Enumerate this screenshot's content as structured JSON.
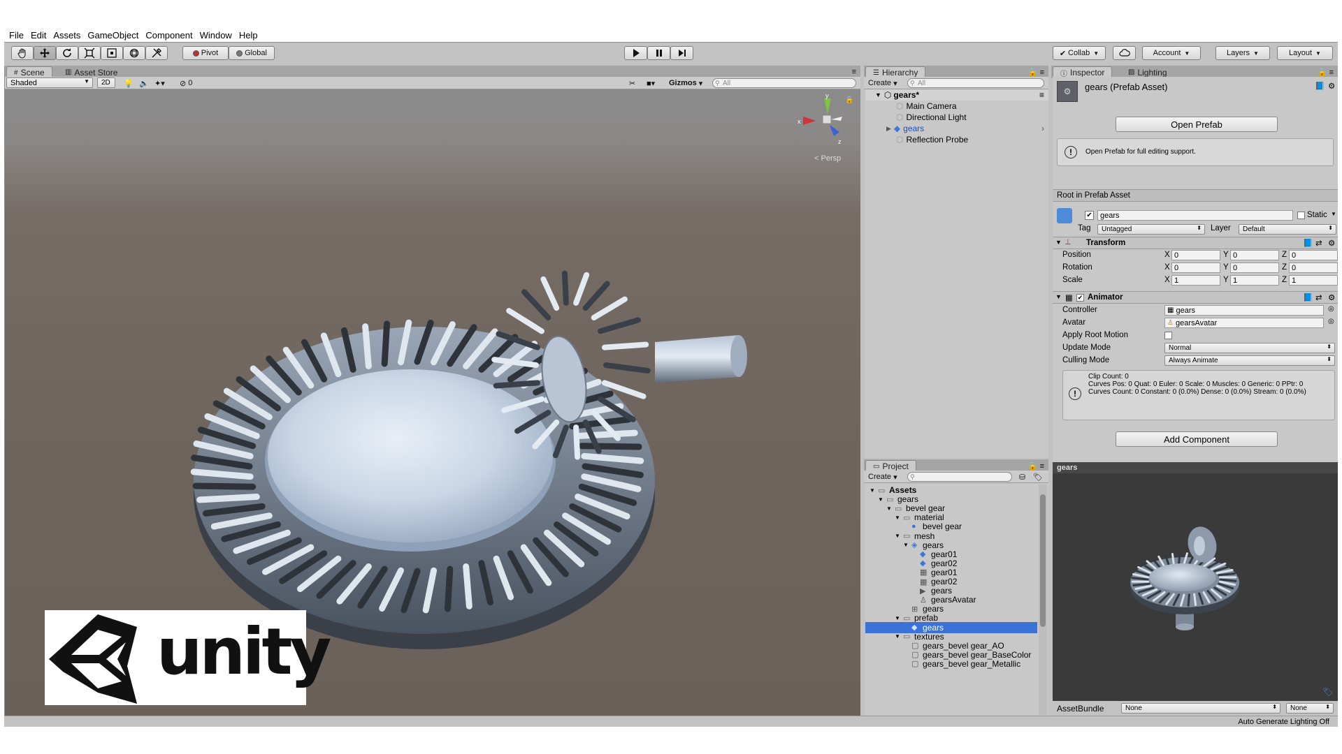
{
  "menu": [
    "File",
    "Edit",
    "Assets",
    "GameObject",
    "Component",
    "Window",
    "Help"
  ],
  "toolbar": {
    "pivot": "Pivot",
    "global": "Global",
    "collab": "Collab",
    "account": "Account",
    "layers": "Layers",
    "layout": "Layout"
  },
  "scene_panel": {
    "tabs": [
      "Scene",
      "Asset Store"
    ],
    "shading": "Shaded",
    "mode_2d": "2D",
    "hidden_count": "0",
    "gizmos": "Gizmos",
    "search_placeholder": "All",
    "persp": "Persp",
    "gizmo_axes": {
      "x": "x",
      "y": "y",
      "z": "z"
    }
  },
  "hierarchy": {
    "tab": "Hierarchy",
    "create": "Create",
    "search_placeholder": "All",
    "scene_name": "gears*",
    "items": [
      "Main Camera",
      "Directional Light",
      "gears",
      "Reflection Probe"
    ]
  },
  "project": {
    "tab": "Project",
    "create": "Create",
    "tree": [
      {
        "label": "Assets",
        "depth": 0,
        "type": "folder",
        "bold": true
      },
      {
        "label": "gears",
        "depth": 1,
        "type": "folder"
      },
      {
        "label": "bevel gear",
        "depth": 2,
        "type": "folder"
      },
      {
        "label": "material",
        "depth": 3,
        "type": "folder"
      },
      {
        "label": "bevel gear",
        "depth": 4,
        "type": "material"
      },
      {
        "label": "mesh",
        "depth": 3,
        "type": "folder"
      },
      {
        "label": "gears",
        "depth": 4,
        "type": "model"
      },
      {
        "label": "gear01",
        "depth": 5,
        "type": "cube"
      },
      {
        "label": "gear02",
        "depth": 5,
        "type": "cube"
      },
      {
        "label": "gear01",
        "depth": 5,
        "type": "mesh"
      },
      {
        "label": "gear02",
        "depth": 5,
        "type": "mesh"
      },
      {
        "label": "gears",
        "depth": 5,
        "type": "anim"
      },
      {
        "label": "gearsAvatar",
        "depth": 5,
        "type": "avatar"
      },
      {
        "label": "gears",
        "depth": 4,
        "type": "grid"
      },
      {
        "label": "prefab",
        "depth": 3,
        "type": "folder"
      },
      {
        "label": "gears",
        "depth": 4,
        "type": "prefab",
        "selected": true
      },
      {
        "label": "textures",
        "depth": 3,
        "type": "folder"
      },
      {
        "label": "gears_bevel gear_AO",
        "depth": 4,
        "type": "texture"
      },
      {
        "label": "gears_bevel gear_BaseColor",
        "depth": 4,
        "type": "texture"
      },
      {
        "label": "gears_bevel gear_Metallic",
        "depth": 4,
        "type": "texture"
      }
    ]
  },
  "inspector": {
    "tabs": [
      "Inspector",
      "Lighting"
    ],
    "asset_title": "gears (Prefab Asset)",
    "open_prefab": "Open Prefab",
    "info": "Open Prefab for full editing support.",
    "root_label": "Root in Prefab Asset",
    "object_name": "gears",
    "static_label": "Static",
    "tag_label": "Tag",
    "tag_value": "Untagged",
    "layer_label": "Layer",
    "layer_value": "Default",
    "transform": {
      "title": "Transform",
      "position": {
        "label": "Position",
        "x": "0",
        "y": "0",
        "z": "0"
      },
      "rotation": {
        "label": "Rotation",
        "x": "0",
        "y": "0",
        "z": "0"
      },
      "scale": {
        "label": "Scale",
        "x": "1",
        "y": "1",
        "z": "1"
      }
    },
    "animator": {
      "title": "Animator",
      "controller_label": "Controller",
      "controller_value": "gears",
      "avatar_label": "Avatar",
      "avatar_value": "gearsAvatar",
      "root_motion_label": "Apply Root Motion",
      "update_mode_label": "Update Mode",
      "update_mode_value": "Normal",
      "culling_mode_label": "Culling Mode",
      "culling_mode_value": "Always Animate",
      "clip_info": [
        "Clip Count: 0",
        "Curves Pos: 0 Quat: 0 Euler: 0 Scale: 0 Muscles: 0 Generic: 0 PPtr: 0",
        "Curves Count: 0 Constant: 0 (0.0%) Dense: 0 (0.0%) Stream: 0 (0.0%)"
      ]
    },
    "add_component": "Add Component"
  },
  "preview": {
    "title": "gears",
    "assetbundle_label": "AssetBundle",
    "assetbundle_value": "None",
    "variant_value": "None"
  },
  "status": {
    "text": "Auto Generate Lighting Off"
  },
  "logo": {
    "text": "unity"
  }
}
